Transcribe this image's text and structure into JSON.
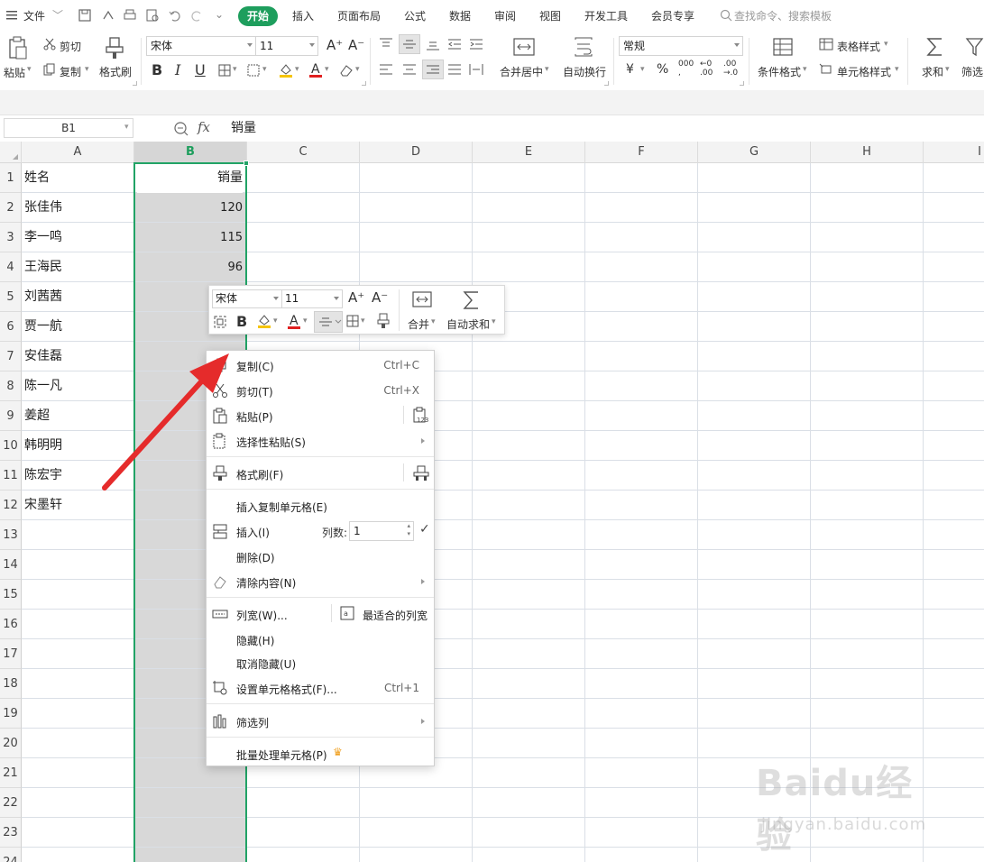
{
  "menubar": {
    "file": "文件",
    "tabs": [
      "开始",
      "插入",
      "页面布局",
      "公式",
      "数据",
      "审阅",
      "视图",
      "开发工具",
      "会员专享"
    ],
    "search_placeholder": "查找命令、搜索模板"
  },
  "ribbon": {
    "paste": "粘贴",
    "cut": "剪切",
    "copy": "复制",
    "format_painter": "格式刷",
    "font_name": "宋体",
    "font_size": "11",
    "merge_center": "合并居中",
    "wrap_text": "自动换行",
    "number_format": "常规",
    "conditional_format": "条件格式",
    "table_style": "表格样式",
    "cell_style": "单元格样式",
    "sum": "求和",
    "filter": "筛选"
  },
  "formula_bar": {
    "cell_ref": "B1",
    "fx": "fx",
    "value": "销量"
  },
  "sheet": {
    "columns": [
      "A",
      "B",
      "C",
      "D",
      "E",
      "F",
      "G",
      "H",
      "I"
    ],
    "rows": [
      "1",
      "2",
      "3",
      "4",
      "5",
      "6",
      "7",
      "8",
      "9",
      "10",
      "11",
      "12",
      "13",
      "14",
      "15",
      "16",
      "17",
      "18",
      "19",
      "20",
      "21",
      "22",
      "23",
      "24"
    ],
    "col_a": [
      "姓名",
      "张佳伟",
      "李一鸣",
      "王海民",
      "刘茜茜",
      "贾一航",
      "安佳磊",
      "陈一凡",
      "姜超",
      "韩明明",
      "陈宏宇",
      "宋墨轩"
    ],
    "col_b": [
      "销量",
      "120",
      "115",
      "96"
    ]
  },
  "minibar": {
    "font_name": "宋体",
    "font_size": "11",
    "merge": "合并",
    "autosum": "自动求和"
  },
  "context_menu": {
    "copy": "复制(C)",
    "copy_sc": "Ctrl+C",
    "cut": "剪切(T)",
    "cut_sc": "Ctrl+X",
    "paste": "粘贴(P)",
    "paste_special": "选择性粘贴(S)",
    "format_painter": "格式刷(F)",
    "insert_copied": "插入复制单元格(E)",
    "insert": "插入(I)",
    "col_count_label": "列数:",
    "col_count": "1",
    "delete": "删除(D)",
    "clear": "清除内容(N)",
    "col_width": "列宽(W)...",
    "best_fit": "最适合的列宽",
    "hide": "隐藏(H)",
    "unhide": "取消隐藏(U)",
    "format_cells": "设置单元格格式(F)...",
    "format_cells_sc": "Ctrl+1",
    "filter_col": "筛选列",
    "batch": "批量处理单元格(P)"
  },
  "watermark": {
    "logo": "Baidu经验",
    "url": "jingyan.baidu.com"
  },
  "colors": {
    "accent": "#1e9e5d",
    "selection": "#21a366",
    "arrow": "#e52b2b"
  }
}
